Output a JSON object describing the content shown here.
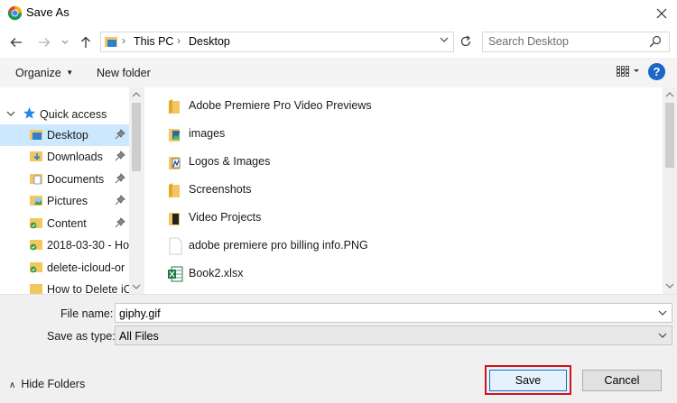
{
  "window": {
    "title": "Save As"
  },
  "address_bar": {
    "crumbs": [
      "This PC",
      "Desktop"
    ]
  },
  "search": {
    "placeholder": "Search Desktop"
  },
  "toolbar": {
    "organize_label": "Organize",
    "new_folder_label": "New folder",
    "help_label": "?"
  },
  "nav_pane": {
    "quick_access_label": "Quick access",
    "items": [
      {
        "label": "Desktop",
        "icon": "desktop-folder-icon",
        "pinned": true,
        "selected": true
      },
      {
        "label": "Downloads",
        "icon": "downloads-folder-icon",
        "pinned": true
      },
      {
        "label": "Documents",
        "icon": "documents-folder-icon",
        "pinned": true
      },
      {
        "label": "Pictures",
        "icon": "pictures-folder-icon",
        "pinned": true
      },
      {
        "label": "Content",
        "icon": "synced-folder-icon",
        "pinned": true
      },
      {
        "label": "2018-03-30 - Ho",
        "icon": "synced-folder-icon",
        "pinned": false
      },
      {
        "label": "delete-icloud-or",
        "icon": "synced-folder-icon",
        "pinned": false
      },
      {
        "label": "How to Delete iC",
        "icon": "folder-icon",
        "pinned": false
      }
    ]
  },
  "files": [
    {
      "name": "Adobe Premiere Pro Video Previews",
      "icon": "folder-icon"
    },
    {
      "name": "images",
      "icon": "image-folder-icon"
    },
    {
      "name": "Logos & Images",
      "icon": "image-folder-icon"
    },
    {
      "name": "Screenshots",
      "icon": "folder-icon"
    },
    {
      "name": "Video Projects",
      "icon": "folder-icon"
    },
    {
      "name": "adobe premiere pro billing info.PNG",
      "icon": "png-file-icon"
    },
    {
      "name": "Book2.xlsx",
      "icon": "excel-file-icon"
    }
  ],
  "form": {
    "file_name_label": "File name:",
    "file_name_value": "giphy.gif",
    "save_type_label": "Save as type:",
    "save_type_value": "All Files"
  },
  "footer": {
    "hide_folders_label": "Hide Folders",
    "save_label": "Save",
    "cancel_label": "Cancel"
  },
  "colors": {
    "accent": "#0078d7",
    "highlight": "#d3121f",
    "selection": "#cce8ff"
  }
}
